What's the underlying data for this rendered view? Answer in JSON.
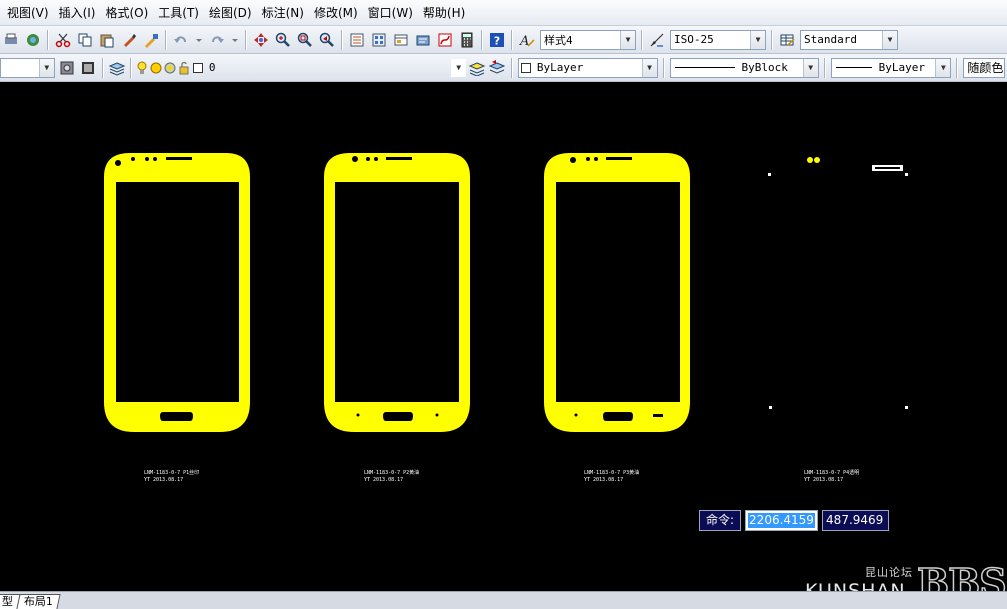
{
  "menu": [
    "视图(V)",
    "插入(I)",
    "格式(O)",
    "工具(T)",
    "绘图(D)",
    "标注(N)",
    "修改(M)",
    "窗口(W)",
    "帮助(H)"
  ],
  "styles": {
    "text_style": "样式4",
    "dim_style": "ISO-25",
    "table_style": "Standard"
  },
  "layer": {
    "name": "0"
  },
  "properties": {
    "color": "ByLayer",
    "linetype": "ByBlock",
    "lineweight": "ByLayer",
    "plot_style": "随颜色"
  },
  "drawing": {
    "fill_color": "#ffff00",
    "labels": [
      {
        "line1": "LNM-1183-0-7  P1丝印",
        "line2": "YT 2013.08.17"
      },
      {
        "line1": "LNM-1183-0-7  P2黄油",
        "line2": "YT 2013.08.17"
      },
      {
        "line1": "LNM-1183-0-7  P3黄油",
        "line2": "YT 2013.08.17"
      },
      {
        "line1": "LNM-1183-0-7  P4透明",
        "line2": "YT 2013.08.17"
      }
    ]
  },
  "command": {
    "label": "命令:",
    "x_value": "2206.4159",
    "y_value": "487.9469"
  },
  "watermark": {
    "small": "昆山论坛",
    "kunshan": "KUNSHAN",
    "bbs": "BBS"
  },
  "tabs": [
    "型",
    "布局1"
  ]
}
